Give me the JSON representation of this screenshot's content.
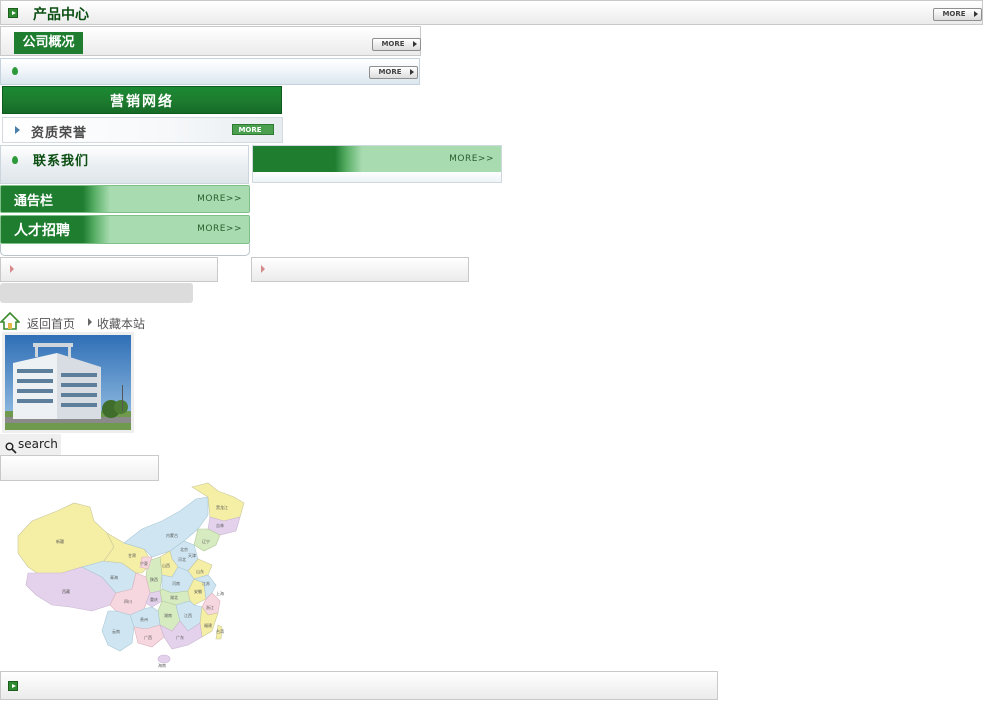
{
  "product_center": {
    "title": "产品中心",
    "more": "MORE"
  },
  "about": {
    "title": "公司概况",
    "more": "MORE"
  },
  "blank_bar": {
    "more": "MORE"
  },
  "sales_network": {
    "title": "营销网络"
  },
  "qualification": {
    "title": "资质荣誉",
    "more": "MORE"
  },
  "contact": {
    "title": "联系我们"
  },
  "right_green_bar": {
    "more": "MORE>>"
  },
  "notice": {
    "title": "通告栏",
    "more": "MORE>>"
  },
  "recruit": {
    "title": "人才招聘",
    "more": "MORE>>"
  },
  "nav": {
    "home": "返回首页",
    "favorite": "收藏本站"
  },
  "search": {
    "label": "search",
    "placeholder": ""
  },
  "map": {
    "provinces": [
      "新疆",
      "西藏",
      "青海",
      "甘肃",
      "内蒙古",
      "黑龙江",
      "吉林",
      "辽宁",
      "北京",
      "天津",
      "河北",
      "山西",
      "陕西",
      "宁夏",
      "山东",
      "河南",
      "四川",
      "重庆",
      "湖北",
      "安徽",
      "江苏",
      "上海",
      "浙江",
      "湖南",
      "江西",
      "福建",
      "贵州",
      "云南",
      "广西",
      "广东",
      "台湾",
      "海南"
    ]
  },
  "colors": {
    "brand_green": "#1e7d2f",
    "light_green": "#a8dbb0",
    "text_dark_green": "#0b4e12"
  },
  "icons": [
    "green-arrow-icon",
    "water-drop-icon",
    "home-icon",
    "magnifier-icon",
    "chevron-right-icon"
  ]
}
